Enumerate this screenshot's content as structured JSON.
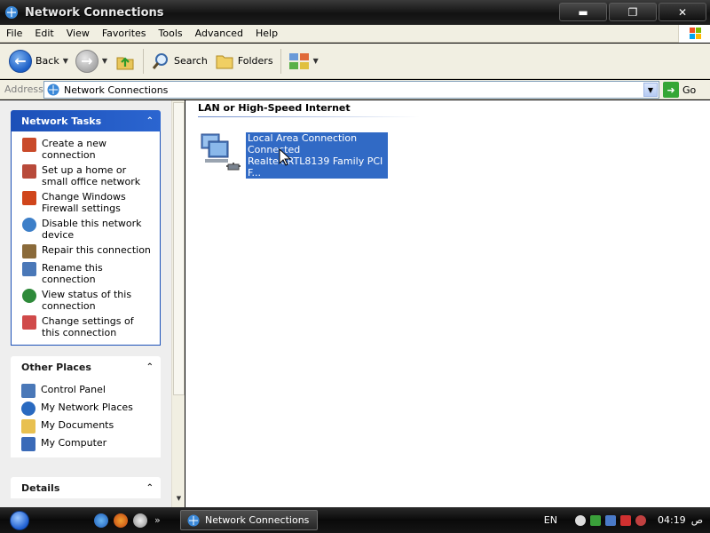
{
  "window": {
    "title": "Network Connections",
    "minimize_glyph": "▬",
    "maximize_glyph": "❐",
    "close_glyph": "✕"
  },
  "menu": {
    "items": [
      "File",
      "Edit",
      "View",
      "Favorites",
      "Tools",
      "Advanced",
      "Help"
    ]
  },
  "toolbar": {
    "back_label": "Back",
    "search_label": "Search",
    "folders_label": "Folders",
    "back_icon": "back-arrow-icon",
    "forward_icon": "forward-arrow-icon",
    "up_icon": "up-folder-icon",
    "search_icon": "search-icon",
    "folders_icon": "folders-icon",
    "views_icon": "views-icon"
  },
  "address": {
    "label": "Address",
    "value": "Network Connections",
    "go_label": "Go"
  },
  "sidebar": {
    "network_tasks": {
      "title": "Network Tasks",
      "items": [
        {
          "label": "Create a new connection",
          "icon": "new-connection-icon",
          "color": "#c94a2a"
        },
        {
          "label": "Set up a home or small office network",
          "icon": "home-network-icon",
          "color": "#b84a3a"
        },
        {
          "label": "Change Windows Firewall settings",
          "icon": "firewall-icon",
          "color": "#d0451b"
        },
        {
          "label": "Disable this network device",
          "icon": "disable-network-icon",
          "color": "#3d7fc8"
        },
        {
          "label": "Repair this connection",
          "icon": "repair-icon",
          "color": "#8a6a3a"
        },
        {
          "label": "Rename this connection",
          "icon": "rename-icon",
          "color": "#4a78b8"
        },
        {
          "label": "View status of this connection",
          "icon": "status-icon",
          "color": "#2e8a3a"
        },
        {
          "label": "Change settings of this connection",
          "icon": "settings-icon",
          "color": "#d04a4a"
        }
      ]
    },
    "other_places": {
      "title": "Other Places",
      "items": [
        {
          "label": "Control Panel",
          "icon": "control-panel-icon",
          "color": "#4a78b8"
        },
        {
          "label": "My Network Places",
          "icon": "network-places-icon",
          "color": "#2a6ac0"
        },
        {
          "label": "My Documents",
          "icon": "documents-icon",
          "color": "#e8c050"
        },
        {
          "label": "My Computer",
          "icon": "computer-icon",
          "color": "#3a6ab8"
        }
      ]
    },
    "details": {
      "title": "Details"
    }
  },
  "content": {
    "group_title": "LAN or High-Speed Internet",
    "connection": {
      "name": "Local Area Connection",
      "status": "Connected",
      "device": "Realtek RTL8139 Family PCI F..."
    }
  },
  "taskbar": {
    "task_label": "Network Connections",
    "more_glyph": "»",
    "language": "EN",
    "time": "04:19",
    "ampm": "ص"
  },
  "colors": {
    "accent_blue": "#316ac5",
    "panel_header_blue": "#1c50b8"
  }
}
